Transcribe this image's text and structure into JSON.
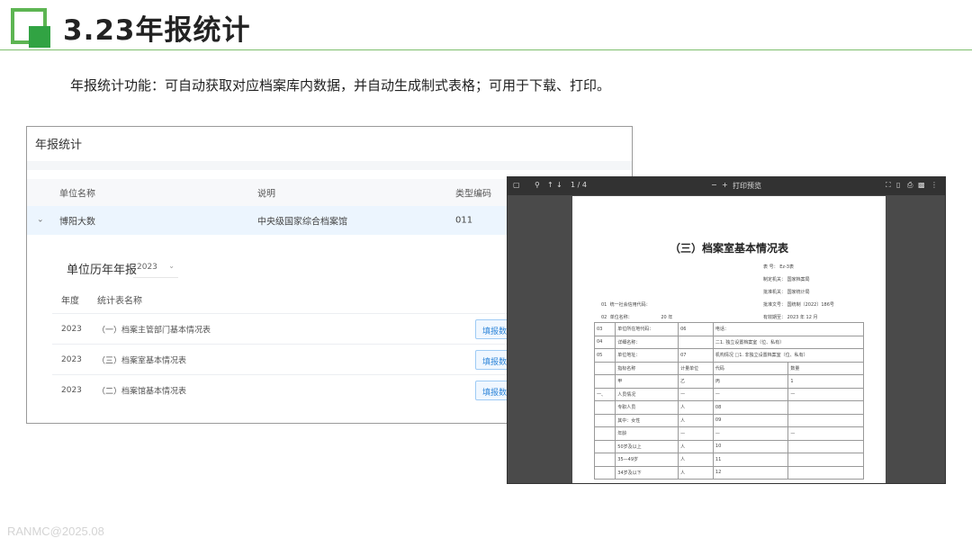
{
  "slide": {
    "title": "3.23年报统计",
    "description": "年报统计功能：可自动获取对应档案库内数据，并自动生成制式表格；可用于下载、打印。",
    "footer": "RANMC@2025.08"
  },
  "app": {
    "title": "年报统计",
    "columns": [
      "单位名称",
      "说明",
      "类型编码"
    ],
    "row": {
      "name": "博阳大数",
      "desc": "中央级国家综合档案馆",
      "code": "011"
    },
    "panel": {
      "title": "单位历年年报",
      "year_value": "2023",
      "columns": [
        "年度",
        "统计表名称"
      ],
      "rows": [
        {
          "year": "2023",
          "name": "（一）档案主管部门基本情况表",
          "action": "填报数据"
        },
        {
          "year": "2023",
          "name": "（三）档案室基本情况表",
          "action": "填报数据"
        },
        {
          "year": "2023",
          "name": "（二）档案馆基本情况表",
          "action": "填报数据"
        }
      ]
    }
  },
  "pdf": {
    "toolbar": {
      "page": "1 / 4",
      "zoom": "打印预览"
    },
    "doc_title": "（三）档案室基本情况表",
    "meta": [
      {
        "label": "表 号：",
        "value": "Ez-3表"
      },
      {
        "label": "制定机关：",
        "value": "国家档案局"
      },
      {
        "label": "批准机关：",
        "value": "国家统计局"
      },
      {
        "label": "批准文号：",
        "value": "国统制〔2022〕186号"
      },
      {
        "label": "有效期至：",
        "value": "2023 年 12 月"
      }
    ],
    "header_lines": [
      {
        "code": "01",
        "text": "统一社会信用代码："
      },
      {
        "code": "02",
        "text": "单位名称：",
        "extra": "20    年"
      }
    ],
    "table_rows": [
      {
        "c1": "03",
        "c2": "单位所在地代码：",
        "c3": "06",
        "c4": "电话："
      },
      {
        "c1": "04",
        "c2": "详细名称：",
        "c3": "",
        "c4": "二1. 独立设置档案室（位、私有）"
      },
      {
        "c1": "05",
        "c2": "单位地址：",
        "c3": "07",
        "c4": "机构情况  □1. 非独立设置档案室（位、私有）"
      },
      {
        "c1": "",
        "c2": "指标名称",
        "c3": "计量单位",
        "c4": "代码",
        "c5": "数量"
      },
      {
        "c1": "",
        "c2": "甲",
        "c3": "乙",
        "c4": "丙",
        "c5": "1"
      },
      {
        "c1": "一、",
        "c2": "人员情况",
        "c3": "—",
        "c4": "—",
        "c5": "—"
      },
      {
        "c1": "",
        "c2": "专职人员",
        "c3": "人",
        "c4": "08",
        "c5": ""
      },
      {
        "c1": "",
        "c2": "    其中：女性",
        "c3": "人",
        "c4": "09",
        "c5": ""
      },
      {
        "c1": "",
        "c2": "年龄",
        "c3": "—",
        "c4": "—",
        "c5": "—"
      },
      {
        "c1": "",
        "c2": "    50岁及以上",
        "c3": "人",
        "c4": "10",
        "c5": ""
      },
      {
        "c1": "",
        "c2": "    35—49岁",
        "c3": "人",
        "c4": "11",
        "c5": ""
      },
      {
        "c1": "",
        "c2": "    34岁及以下",
        "c3": "人",
        "c4": "12",
        "c5": ""
      }
    ]
  }
}
